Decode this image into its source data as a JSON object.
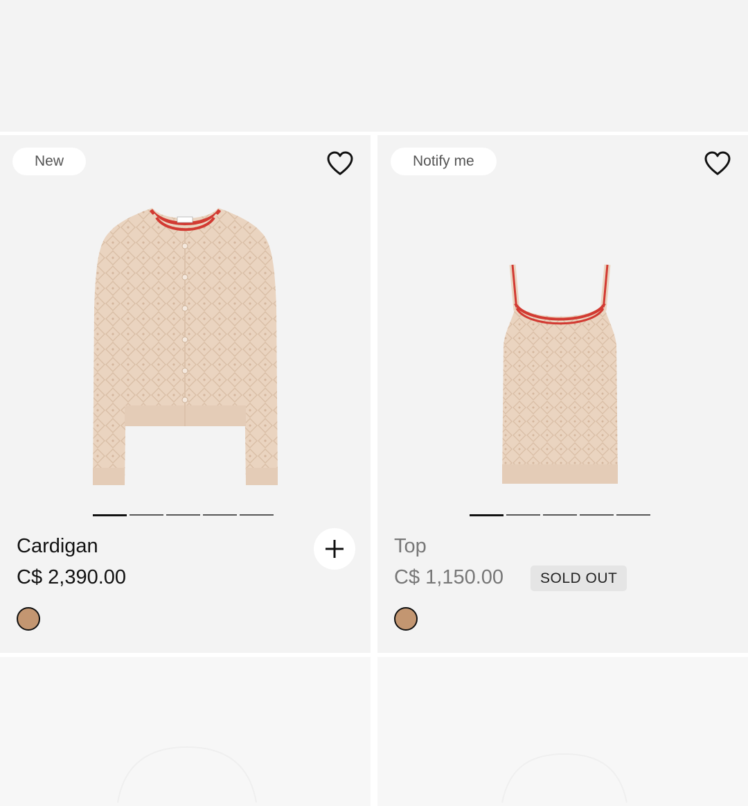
{
  "products": [
    {
      "badge": "New",
      "name": "Cardigan",
      "price": "C$ 2,390.00",
      "swatch_color": "#c39671",
      "image_icon": "cardigan-image",
      "carousel_dots": 5,
      "carousel_active": 1
    },
    {
      "badge": "Notify me",
      "name": "Top",
      "price": "C$ 1,150.00",
      "status": "SOLD OUT",
      "swatch_color": "#c39671",
      "image_icon": "tank-top-image",
      "carousel_dots": 5,
      "carousel_active": 1
    }
  ],
  "icons": {
    "wishlist": "heart-icon",
    "add": "plus-icon"
  },
  "colors": {
    "knit": "#ead4c0",
    "trim_red": "#d23a32",
    "background": "#f3f3f3"
  }
}
